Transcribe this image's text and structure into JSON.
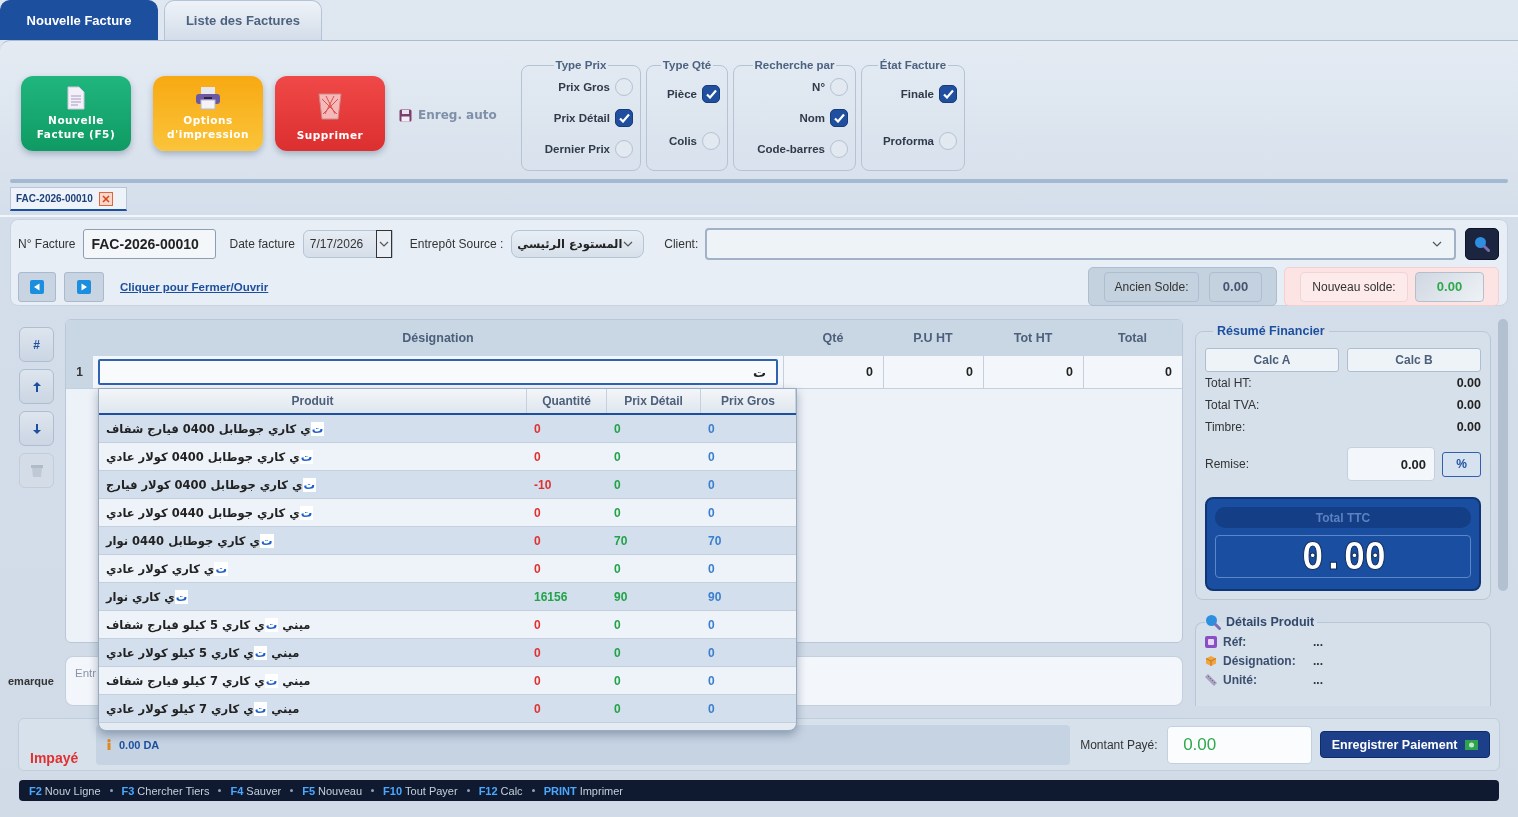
{
  "tabs": [
    {
      "label": "Nouvelle Facture",
      "selected": true
    },
    {
      "label": "Liste des Factures",
      "selected": false
    }
  ],
  "toolbar": {
    "buttons": [
      {
        "kind": "new",
        "label": "Nouvelle Facture (F5)"
      },
      {
        "kind": "print",
        "label": "Options d'impression"
      },
      {
        "kind": "delete",
        "label": "Supprimer"
      }
    ],
    "autosave": "Enreg. auto"
  },
  "option_groups": [
    {
      "title": "Type Prix",
      "options": [
        {
          "label": "Prix Gros",
          "selected": false
        },
        {
          "label": "Prix Détail",
          "selected": true
        },
        {
          "label": "Dernier Prix",
          "selected": false
        }
      ]
    },
    {
      "title": "Type Qté",
      "options": [
        {
          "label": "Pièce",
          "selected": true
        },
        {
          "label": "Colis",
          "selected": false
        }
      ]
    },
    {
      "title": "Recherche par",
      "options": [
        {
          "label": "N°",
          "selected": false
        },
        {
          "label": "Nom",
          "selected": true
        },
        {
          "label": "Code-barres",
          "selected": false
        }
      ]
    },
    {
      "title": "État Facture",
      "options": [
        {
          "label": "Finale",
          "selected": true
        },
        {
          "label": "Proforma",
          "selected": false
        }
      ]
    }
  ],
  "document_tabs": [
    {
      "label": "FAC-2026-00010",
      "selected": true
    }
  ],
  "invoice_header": {
    "number_label": "N° Facture",
    "number": "FAC-2026-00010",
    "date_label": "Date facture",
    "date": "7/17/2026",
    "warehouse_label": "Entrepôt Source :",
    "warehouse": "المستودع الرئيسي",
    "client_label": "Client:",
    "toggle_link": "Cliquer pour Fermer/Ouvrir",
    "old_balance_label": "Ancien Solde:",
    "old_balance": "0.00",
    "new_balance_label": "Nouveau solde:",
    "new_balance": "0.00"
  },
  "row_tools": [
    {
      "kind": "number",
      "label": "#",
      "disabled": false
    },
    {
      "kind": "up",
      "disabled": false
    },
    {
      "kind": "down",
      "disabled": false
    },
    {
      "kind": "delete",
      "disabled": true
    }
  ],
  "lines_table": {
    "columns": [
      "Désignation",
      "Qté",
      "P.U HT",
      "Tot HT",
      "Total"
    ],
    "rows": [
      {
        "number": "1",
        "designation": "ت",
        "qty": "0",
        "unit_price": "0",
        "total_ht": "0",
        "total": "0"
      }
    ]
  },
  "product_search": {
    "columns": [
      "Produit",
      "Quantité",
      "Prix Détail",
      "Prix Gros"
    ],
    "rows": [
      {
        "name": {
          "match": "ت",
          "rest": "ي كاري جوطابل 0400 فيارج شفاف"
        },
        "quantity": "0",
        "in_stock": false,
        "retail_price": "0",
        "wholesale_price": "0"
      },
      {
        "name": {
          "match": "ت",
          "rest": "ي كاري جوطابل 0400 كولار عادي"
        },
        "quantity": "0",
        "in_stock": false,
        "retail_price": "0",
        "wholesale_price": "0"
      },
      {
        "name": {
          "match": "ت",
          "rest": "ي كاري جوطابل 0400 كولار فيارج"
        },
        "quantity": "-10",
        "in_stock": false,
        "retail_price": "0",
        "wholesale_price": "0"
      },
      {
        "name": {
          "match": "ت",
          "rest": "ي كاري جوطابل 0440 كولار عادي"
        },
        "quantity": "0",
        "in_stock": false,
        "retail_price": "0",
        "wholesale_price": "0"
      },
      {
        "name": {
          "match": "ت",
          "rest": "ي كاري جوطابل 0440 نوار"
        },
        "quantity": "0",
        "in_stock": false,
        "retail_price": "70",
        "wholesale_price": "70"
      },
      {
        "name": {
          "match": "ت",
          "rest": "ي كاري كولار عادي"
        },
        "quantity": "0",
        "in_stock": false,
        "retail_price": "0",
        "wholesale_price": "0"
      },
      {
        "name": {
          "match": "ت",
          "rest": "ي كاري نوار"
        },
        "quantity": "16156",
        "in_stock": true,
        "retail_price": "90",
        "wholesale_price": "90"
      },
      {
        "name": {
          "prefix": "ميني ",
          "match": "ت",
          "rest": "ي كاري 5 كيلو فيارج شفاف"
        },
        "quantity": "0",
        "in_stock": false,
        "retail_price": "0",
        "wholesale_price": "0"
      },
      {
        "name": {
          "prefix": "ميني ",
          "match": "ت",
          "rest": "ي كاري 5 كيلو كولار عادي"
        },
        "quantity": "0",
        "in_stock": false,
        "retail_price": "0",
        "wholesale_price": "0"
      },
      {
        "name": {
          "prefix": "ميني ",
          "match": "ت",
          "rest": "ي كاري 7 كيلو فيارج شفاف"
        },
        "quantity": "0",
        "in_stock": false,
        "retail_price": "0",
        "wholesale_price": "0"
      },
      {
        "name": {
          "prefix": "ميني ",
          "match": "ت",
          "rest": "ي كاري 7 كيلو كولار عادي"
        },
        "quantity": "0",
        "in_stock": false,
        "retail_price": "0",
        "wholesale_price": "0"
      }
    ]
  },
  "remarks": {
    "label": "emarque",
    "placeholder": "Entr"
  },
  "summary": {
    "title": "Résumé Financier",
    "buttons": [
      "Calc A",
      "Calc B"
    ],
    "rows": [
      {
        "label": "Total HT:",
        "value": "0.00"
      },
      {
        "label": "Total TVA:",
        "value": "0.00"
      },
      {
        "label": "Timbre:",
        "value": "0.00"
      }
    ],
    "discount_label": "Remise:",
    "discount": "0.00",
    "discount_unit": "%",
    "total_label": "Total TTC",
    "total": "0.00"
  },
  "product_details": {
    "title": "Détails Produit",
    "rows": [
      {
        "kind": "ref",
        "label": "Réf:",
        "value": "..."
      },
      {
        "kind": "name",
        "label": "Désignation:",
        "value": "..."
      },
      {
        "kind": "unit",
        "label": "Unité:",
        "value": "..."
      }
    ]
  },
  "payment": {
    "status": "Impayé",
    "due": "0.00 DA",
    "paid_label": "Montant Payé:",
    "paid": "0.00",
    "save_button": "Enregistrer Paiement"
  },
  "shortcuts": [
    {
      "key": "F2",
      "label": "Nouv Ligne"
    },
    {
      "key": "F3",
      "label": "Chercher Tiers"
    },
    {
      "key": "F4",
      "label": "Sauver"
    },
    {
      "key": "F5",
      "label": "Nouveau"
    },
    {
      "key": "F10",
      "label": "Tout Payer"
    },
    {
      "key": "F12",
      "label": "Calc"
    },
    {
      "key": "PRINT",
      "label": "Imprimer"
    }
  ]
}
